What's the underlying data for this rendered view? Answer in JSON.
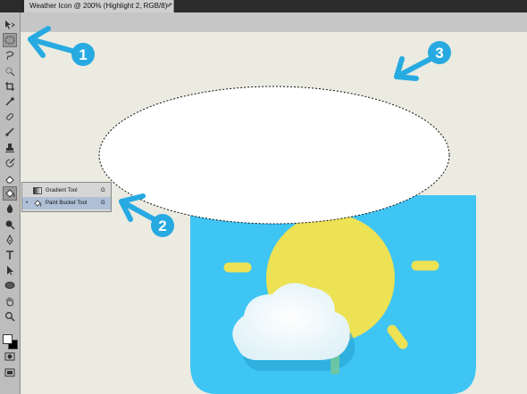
{
  "document_tab": {
    "title": "Weather Icon @ 200% (Highlight 2, RGB/8) *",
    "close": "×"
  },
  "tools": [
    {
      "name": "move-tool",
      "icon": "move-icon"
    },
    {
      "name": "elliptical-marquee-tool",
      "icon": "ellipse-marquee-icon",
      "active": true
    },
    {
      "name": "lasso-tool",
      "icon": "lasso-icon"
    },
    {
      "name": "quick-selection-tool",
      "icon": "quick-selection-icon"
    },
    {
      "name": "crop-tool",
      "icon": "crop-icon"
    },
    {
      "name": "eyedropper-tool",
      "icon": "eyedropper-icon"
    },
    {
      "name": "healing-brush-tool",
      "icon": "healing-icon"
    },
    {
      "name": "brush-tool",
      "icon": "brush-icon"
    },
    {
      "name": "clone-stamp-tool",
      "icon": "stamp-icon"
    },
    {
      "name": "history-brush-tool",
      "icon": "history-brush-icon"
    },
    {
      "name": "eraser-tool",
      "icon": "eraser-icon"
    },
    {
      "name": "paint-bucket-tool",
      "icon": "paint-bucket-icon",
      "active": true
    },
    {
      "name": "blur-tool",
      "icon": "blur-icon"
    },
    {
      "name": "dodge-tool",
      "icon": "dodge-icon"
    },
    {
      "name": "pen-tool",
      "icon": "pen-icon"
    },
    {
      "name": "type-tool",
      "icon": "type-icon"
    },
    {
      "name": "path-selection-tool",
      "icon": "path-selection-icon"
    },
    {
      "name": "ellipse-shape-tool",
      "icon": "ellipse-shape-icon"
    },
    {
      "name": "hand-tool",
      "icon": "hand-icon"
    },
    {
      "name": "zoom-tool",
      "icon": "zoom-icon"
    }
  ],
  "flyout": {
    "items": [
      {
        "label": "Gradient Tool",
        "shortcut": "G",
        "icon": "gradient-icon",
        "selected": false
      },
      {
        "label": "Paint Bucket Tool",
        "shortcut": "G",
        "icon": "paint-bucket-icon",
        "selected": true,
        "bullet": "•"
      }
    ]
  },
  "callouts": [
    {
      "number": "1",
      "color": "#27aae1"
    },
    {
      "number": "2",
      "color": "#27aae1"
    },
    {
      "number": "3",
      "color": "#27aae1"
    }
  ],
  "colors": {
    "canvas_bg": "#ebebe1",
    "icon_blue": "#3ec5f3",
    "sun_yellow": "#ede154",
    "cloud_white": "#f2f9fb",
    "callout_blue": "#27aae1",
    "foreground_swatch": "#ffffff",
    "background_swatch": "#000000"
  }
}
